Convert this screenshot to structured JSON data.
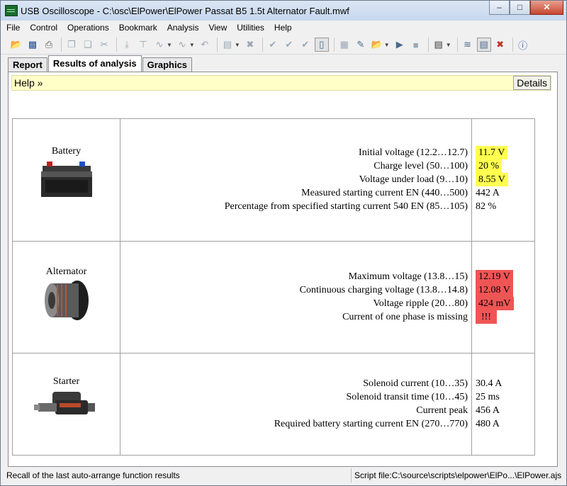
{
  "window": {
    "title": "USB Oscilloscope - C:\\osc\\ElPower\\ElPower Passat B5 1.5t Alternator Fault.mwf"
  },
  "menu": [
    "File",
    "Control",
    "Operations",
    "Bookmark",
    "Analysis",
    "View",
    "Utilities",
    "Help"
  ],
  "tabs": [
    "Report",
    "Results of analysis",
    "Graphics"
  ],
  "helpbar": {
    "help_label": "Help »",
    "details_label": "Details"
  },
  "sections": [
    {
      "component": "Battery",
      "icon": "battery-icon",
      "rows": [
        {
          "label": "Initial voltage (12.2…12.7)",
          "value": "11.7 V",
          "status": "warning"
        },
        {
          "label": "Charge level (50…100)",
          "value": "20 %",
          "status": "warning"
        },
        {
          "label": "Voltage under load (9…10)",
          "value": "8.55 V",
          "status": "warning"
        },
        {
          "label": "Measured starting current EN (440…500)",
          "value": "442 A",
          "status": "ok"
        },
        {
          "label": "Percentage from specified starting current 540 EN (85…105)",
          "value": "82 %",
          "status": "ok"
        }
      ]
    },
    {
      "component": "Alternator",
      "icon": "alternator-icon",
      "rows": [
        {
          "label": "Maximum voltage (13.8…15)",
          "value": "12.19 V",
          "status": "fault"
        },
        {
          "label": "Continuous charging voltage (13.8…14.8)",
          "value": "12.08 V",
          "status": "fault"
        },
        {
          "label": "Voltage ripple (20…80)",
          "value": "424 mV",
          "status": "fault"
        },
        {
          "label": "Current of one phase is missing",
          "value": "!!!",
          "status": "fault"
        }
      ]
    },
    {
      "component": "Starter",
      "icon": "starter-icon",
      "rows": [
        {
          "label": "Solenoid current (10…35)",
          "value": "30.4 A",
          "status": "ok"
        },
        {
          "label": "Solenoid transit time (10…45)",
          "value": "25 ms",
          "status": "ok"
        },
        {
          "label": "Current peak",
          "value": "456 A",
          "status": "ok"
        },
        {
          "label": "Required battery starting current EN (270…770)",
          "value": "480 A",
          "status": "ok"
        }
      ]
    }
  ],
  "colors": {
    "warning": "#ffff50",
    "fault": "#f05555"
  },
  "statusbar": {
    "left": "Recall of the last auto-arrange function results",
    "right": "Script file:C:\\source\\scripts\\elpower\\ElPo...\\ElPower.ajs"
  }
}
